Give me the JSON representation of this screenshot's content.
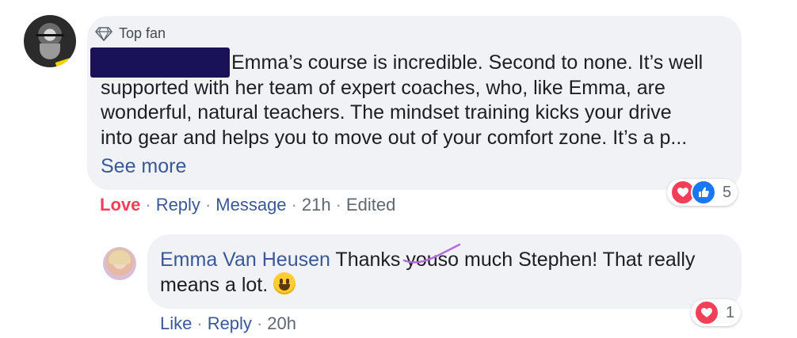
{
  "comment": {
    "badge_label": "Top fan",
    "badge_icon": "diamond-icon",
    "lines": [
      "Emma’s course is incredible. Second to none. It’s well",
      "supported with her team of expert coaches, who, like Emma, are",
      "wonderful, natural teachers. The mindset training kicks your drive",
      "into gear and helps you to move out of your comfort zone. It’s a p..."
    ],
    "see_more": "See more",
    "reaction_count": "5",
    "reactions": [
      "love-icon",
      "like-icon"
    ],
    "actions": {
      "love": "Love",
      "reply": "Reply",
      "message": "Message",
      "time": "21h",
      "edited": "Edited",
      "separator": "·"
    }
  },
  "reply": {
    "author": "Emma Van Heusen",
    "text_before": "Thanks ",
    "struck_word": "you",
    "text_after": "so much Stephen! That really",
    "line2": "means a lot. ",
    "emoji": "grinning-face-emoji",
    "reaction_count": "1",
    "reactions": [
      "love-icon"
    ],
    "actions": {
      "like": "Like",
      "reply": "Reply",
      "time": "20h",
      "separator": "·"
    }
  },
  "colors": {
    "link": "#385898",
    "love": "#f33e58",
    "like": "#1877f2",
    "bubble": "#f0f2f5",
    "redaction": "#1a1258",
    "annotation": "#b36ae0"
  }
}
